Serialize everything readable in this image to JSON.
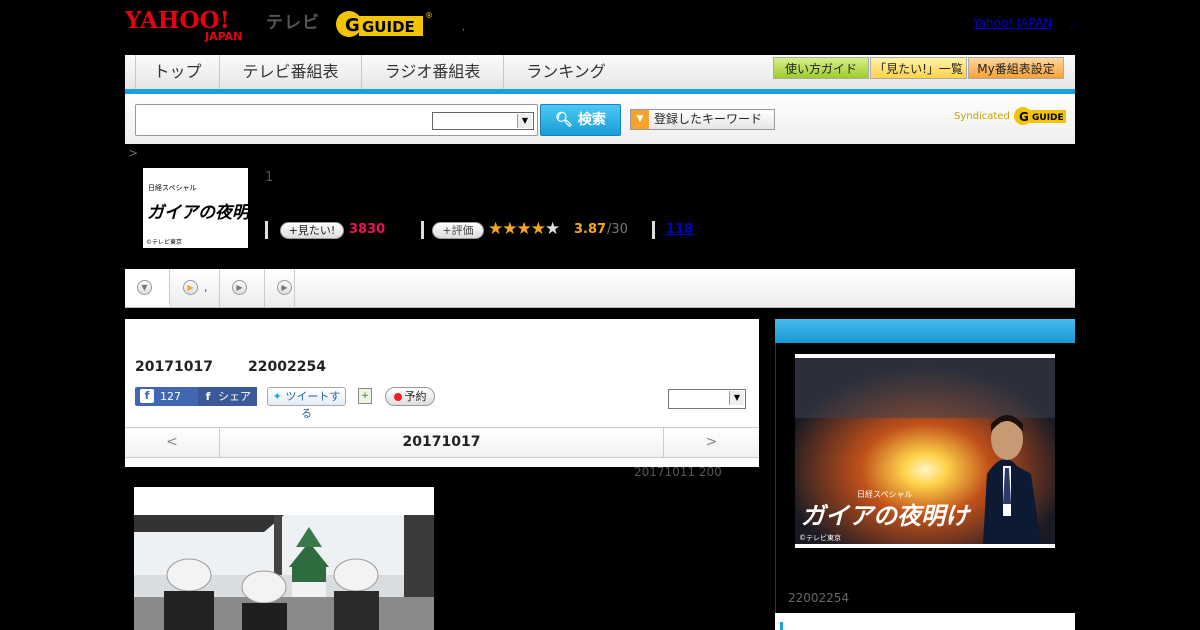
{
  "header": {
    "yahoo_logo": "YAHOO!",
    "yahoo_japan_small": "JAPAN",
    "tv_label": "テレビ",
    "gguide_logo": "GUIDE",
    "dot": ",",
    "yahoo_japan_link": "Yahoo! JAPAN",
    "link_dot": ","
  },
  "nav": {
    "tabs": [
      "トップ",
      "テレビ番組表",
      "ラジオ番組表",
      "ランキング"
    ],
    "pills": [
      "使い方ガイド",
      "「見たい!」一覧",
      "My番組表設定"
    ]
  },
  "search": {
    "placeholder": "",
    "button_label": "検索",
    "keyword_button": "登録したキーワード",
    "syndicated": "Syndicated",
    "badge": "GUIDE"
  },
  "breadcrumb": ">",
  "program": {
    "thumb_caption_top": "日経スペシャル",
    "thumb_title": "ガイアの夜明け",
    "thumb_credit": "©テレビ東京",
    "number": "1",
    "want_label": "見たい!",
    "want_count": "3830",
    "rate_label": "評価",
    "stars": 3.5,
    "rating_value": "3.87",
    "rating_total": "/30",
    "review_count": "118"
  },
  "tabs": {
    "items": [
      {
        "icon": "down-arrow-icon",
        "label": ""
      },
      {
        "icon": "play-icon",
        "label": ","
      },
      {
        "icon": "play-icon",
        "label": ""
      },
      {
        "icon": "play-icon",
        "label": ""
      }
    ]
  },
  "episode": {
    "date": "20171017",
    "id": "22002254",
    "like_count": "127",
    "share_label": "シェア",
    "tweet_label": "ツイートする",
    "reserve_label": "予約",
    "nav_prev": "<",
    "nav_title": "20171017",
    "nav_next": ">"
  },
  "broadcast_info": "20171011  200",
  "side": {
    "caption_top": "日経スペシャル",
    "title": "ガイアの夜明け",
    "credit": "©テレビ東京",
    "id": "22002254"
  },
  "colors": {
    "accent_blue": "#1ea0dc",
    "want_pink": "#e6145a",
    "star_orange": "#f6a623",
    "link_blue": "#0000cc"
  }
}
